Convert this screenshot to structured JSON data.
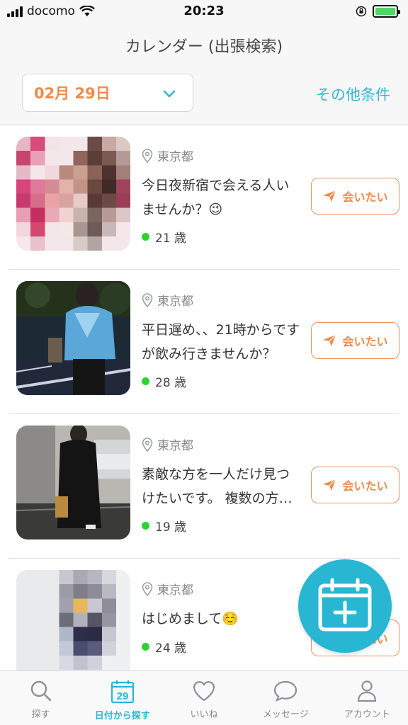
{
  "status_bar": {
    "carrier": "docomo",
    "time": "20:23"
  },
  "header": {
    "title": "カレンダー (出張検索)",
    "date": "02月 29日",
    "other_conditions": "その他条件"
  },
  "colors": {
    "accent": "#29b6d3",
    "orange": "#f08a4b",
    "online": "#2ed22e"
  },
  "items": [
    {
      "location": "東京都",
      "message": "今日夜新宿で会える人いませんか？😉",
      "age": "21 歳",
      "button": "会いたい"
    },
    {
      "location": "東京都",
      "message": "平日遅め、、21時からですが飲み行きませんか？",
      "age": "28 歳",
      "button": "会いたい"
    },
    {
      "location": "東京都",
      "message": "素敵な方を一人だけ見つけたいです。 複数の方…",
      "age": "19 歳",
      "button": "会いたい"
    },
    {
      "location": "東京都",
      "message": "はじめまして☺️",
      "age": "24 歳",
      "button": "会いたい"
    }
  ],
  "calendar_icon_day": "29",
  "tabs": [
    {
      "label": "探す",
      "icon": "search-icon"
    },
    {
      "label": "日付から探す",
      "icon": "calendar-icon"
    },
    {
      "label": "いいね",
      "icon": "heart-icon"
    },
    {
      "label": "メッセージ",
      "icon": "chat-bubble-icon"
    },
    {
      "label": "アカウント",
      "icon": "person-icon"
    }
  ]
}
